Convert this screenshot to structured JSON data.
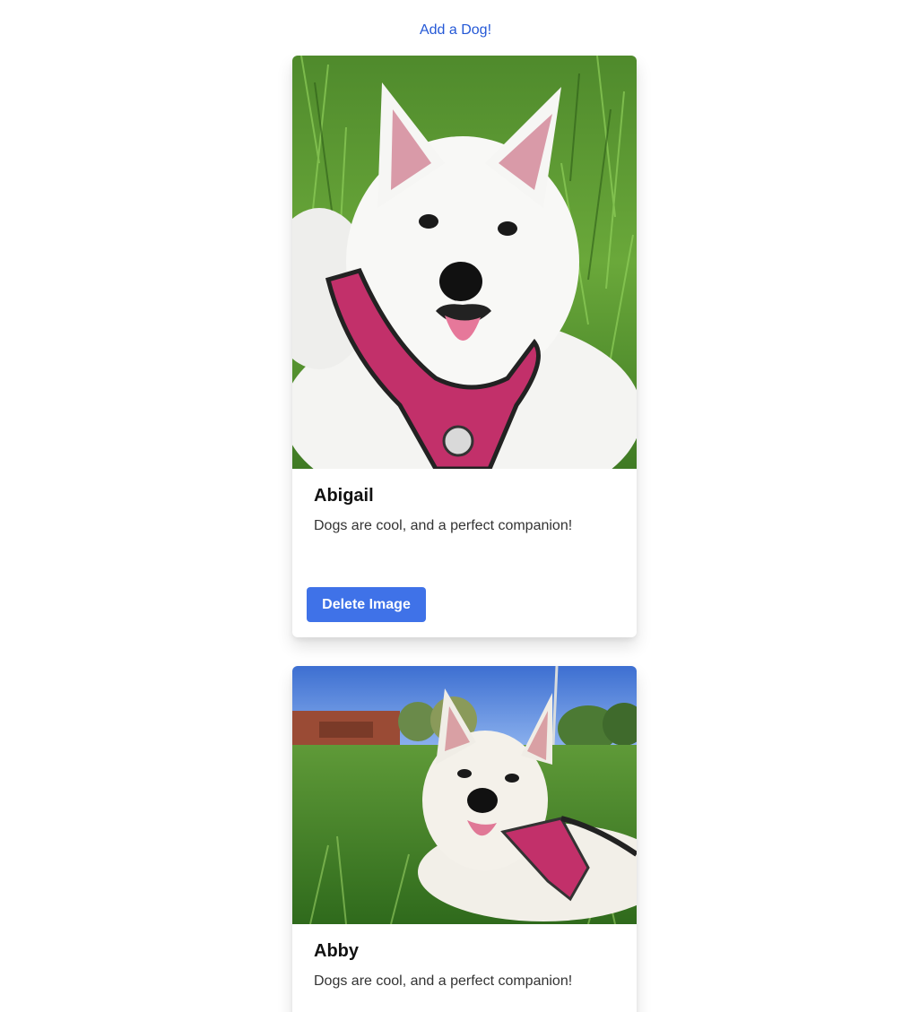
{
  "header": {
    "add_link_label": "Add a Dog!"
  },
  "colors": {
    "link": "#2458d6",
    "button": "#3f72e8",
    "harness": "#c2306a"
  },
  "dogs": [
    {
      "name": "Abigail",
      "description": "Dogs are cool, and a perfect companion!",
      "delete_label": "Delete Image"
    },
    {
      "name": "Abby",
      "description": "Dogs are cool, and a perfect companion!"
    }
  ]
}
